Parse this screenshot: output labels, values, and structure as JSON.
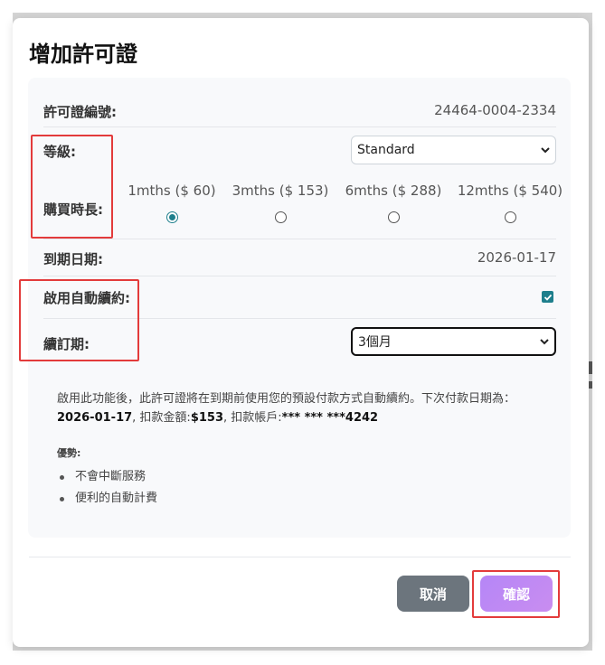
{
  "modal": {
    "title": "增加許可證"
  },
  "fields": {
    "license_no": {
      "label": "許可證編號:",
      "value": "24464-0004-2334"
    },
    "level": {
      "label": "等級:",
      "selected": "Standard"
    },
    "duration": {
      "label": "購買時長:",
      "options": [
        {
          "label": "1mths ($ 60)",
          "checked": true
        },
        {
          "label": "3mths ($ 153)",
          "checked": false
        },
        {
          "label": "6mths ($ 288)",
          "checked": false
        },
        {
          "label": "12mths ($ 540)",
          "checked": false
        }
      ]
    },
    "expiry": {
      "label": "到期日期:",
      "value": "2026-01-17"
    },
    "auto_renew": {
      "label": "啟用自動續約:",
      "checked": true
    },
    "renew_period": {
      "label": "續訂期:",
      "selected": "3個月"
    }
  },
  "info": {
    "text1": "啟用此功能後，此許可證將在到期前使用您的預設付款方式自動續約。下次付款日期為：",
    "date": "2026-01-17",
    "text2": ", 扣款金額:",
    "amount": "$153",
    "text3": ", 扣款帳戶:",
    "account": "*** *** ***4242"
  },
  "advantages": {
    "title": "優勢:",
    "items": [
      "不會中斷服務",
      "便利的自動計費"
    ]
  },
  "buttons": {
    "cancel": "取消",
    "confirm": "確認"
  },
  "colors": {
    "accent": "#1e7f8c",
    "confirm": "#c08af5",
    "cancel": "#6c757d",
    "highlight": "#e33b3b"
  }
}
